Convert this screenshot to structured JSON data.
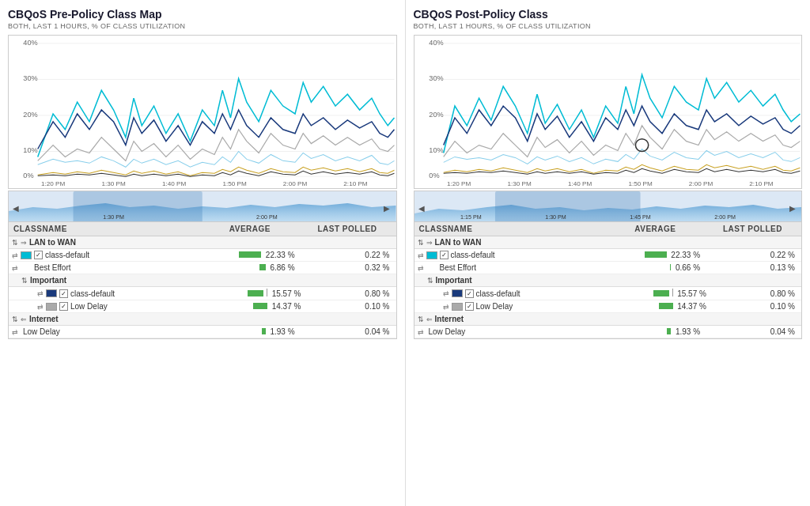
{
  "panels": [
    {
      "id": "pre-policy",
      "title": "CBQoS Pre-Policy Class Map",
      "subtitle": "BOTH, LAST 1 HOURS, % OF CLASS UTILIZATION",
      "chart": {
        "yLabels": [
          "40%",
          "30%",
          "20%",
          "10%",
          "0%"
        ],
        "xLabels": [
          "1:20 PM",
          "1:30 PM",
          "1:40 PM",
          "1:50 PM",
          "2:00 PM",
          "2:10 PM"
        ],
        "miniLabels": [
          "1:30 PM",
          "2:00 PM"
        ]
      },
      "table": {
        "headers": [
          "CLASSNAME",
          "AVERAGE",
          "LAST POLLED"
        ],
        "groups": [
          {
            "label": "LAN to WAN",
            "direction": "→",
            "rows": [
              {
                "name": "class-default",
                "color": "cyan",
                "avg": "22.33 %",
                "last": "0.22 %",
                "barWidth": 28,
                "hasCheck": true,
                "indent": 0
              },
              {
                "name": "Best Effort",
                "color": null,
                "avg": "6.86 %",
                "last": "0.32 %",
                "barWidth": 8,
                "hasCheck": false,
                "indent": 0
              },
              {
                "name": "Important",
                "isGroup": true,
                "rows": [
                  {
                    "name": "class-default",
                    "color": "navy",
                    "avg": "15.57 %",
                    "last": "0.80 %",
                    "barWidth": 20,
                    "hasCheck": true
                  },
                  {
                    "name": "Low Delay",
                    "color": "gray",
                    "avg": "14.37 %",
                    "last": "0.10 %",
                    "barWidth": 18,
                    "hasCheck": true
                  }
                ]
              }
            ]
          },
          {
            "label": "Internet",
            "direction": "←",
            "rows": [
              {
                "name": "Low Delay",
                "color": null,
                "avg": "1.93 %",
                "last": "0.04 %",
                "barWidth": 5,
                "hasCheck": false,
                "indent": 0
              }
            ]
          }
        ]
      }
    },
    {
      "id": "post-policy",
      "title": "CBQoS Post-Policy Class",
      "subtitle": "BOTH, LAST 1 HOURS, % OF CLASS UTILIZATION",
      "chart": {
        "yLabels": [
          "40%",
          "30%",
          "20%",
          "10%",
          "0%"
        ],
        "xLabels": [
          "1:20 PM",
          "1:30 PM",
          "1:40 PM",
          "1:50 PM",
          "2:00 PM",
          "2:10 PM"
        ],
        "miniLabels": [
          "1:15 PM",
          "1:30 PM",
          "1:45 PM",
          "2:00 PM"
        ]
      },
      "table": {
        "headers": [
          "CLASSNAME",
          "AVERAGE",
          "LAST POLLED"
        ],
        "groups": [
          {
            "label": "LAN to WAN",
            "direction": "→",
            "rows": [
              {
                "name": "class-default",
                "color": "cyan",
                "avg": "22.33 %",
                "last": "0.22 %",
                "barWidth": 28,
                "hasCheck": true,
                "indent": 0
              },
              {
                "name": "Best Effort",
                "color": null,
                "avg": "0.66 %",
                "last": "0.13 %",
                "barWidth": 1,
                "hasCheck": false,
                "indent": 0
              },
              {
                "name": "Important",
                "isGroup": true,
                "rows": [
                  {
                    "name": "class-default",
                    "color": "navy",
                    "avg": "15.57 %",
                    "last": "0.80 %",
                    "barWidth": 20,
                    "hasCheck": true
                  },
                  {
                    "name": "Low Delay",
                    "color": "gray",
                    "avg": "14.37 %",
                    "last": "0.10 %",
                    "barWidth": 18,
                    "hasCheck": true
                  }
                ]
              }
            ]
          },
          {
            "label": "Internet",
            "direction": "←",
            "rows": [
              {
                "name": "Low Delay",
                "color": null,
                "avg": "1.93 %",
                "last": "0.04 %",
                "barWidth": 5,
                "hasCheck": false,
                "indent": 0
              }
            ]
          }
        ]
      }
    }
  ]
}
